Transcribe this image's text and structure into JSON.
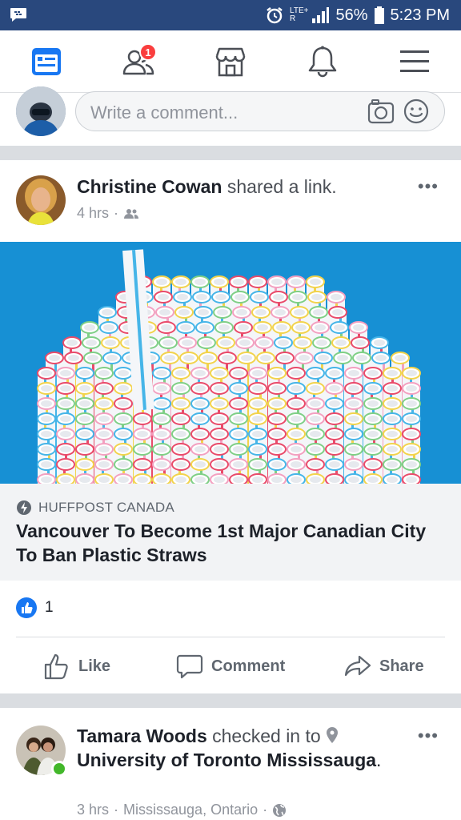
{
  "status_bar": {
    "network": "LTE+",
    "network_sub": "R",
    "battery": "56%",
    "time": "5:23 PM"
  },
  "nav": {
    "friend_requests_badge": "1"
  },
  "comment_box": {
    "placeholder": "Write a comment..."
  },
  "post1": {
    "author": "Christine Cowan",
    "action": "shared a link.",
    "time": "4 hrs",
    "link": {
      "source": "HUFFPOST CANADA",
      "title": "Vancouver To Become 1st Major Canadian City To Ban Plastic Straws"
    },
    "reaction_count": "1",
    "actions": {
      "like": "Like",
      "comment": "Comment",
      "share": "Share"
    }
  },
  "post2": {
    "author": "Tamara Woods",
    "action": "checked in to",
    "place": "University of Toronto Mississauga",
    "place_suffix": ".",
    "time": "3 hrs",
    "location": "Mississauga, Ontario"
  },
  "colors": {
    "status_bar": "#29487d",
    "facebook_blue": "#1877f2",
    "badge_red": "#fa3e3e",
    "link_image_bg": "#1790d4"
  }
}
